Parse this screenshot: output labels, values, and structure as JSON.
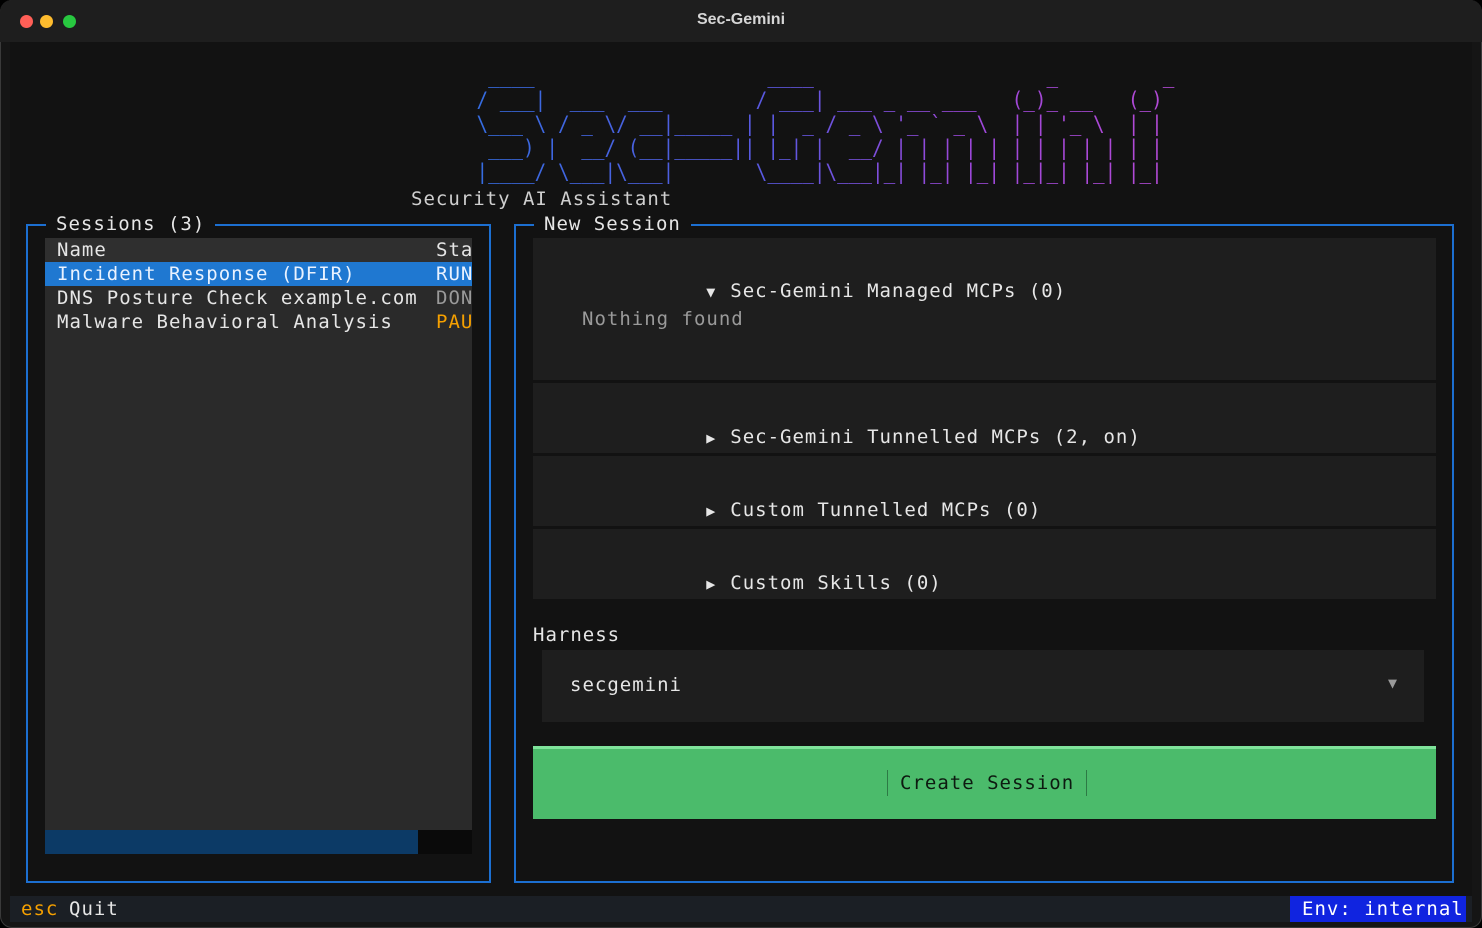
{
  "window": {
    "title": "Sec-Gemini"
  },
  "logo": {
    "ascii": "     ____                    ____                    _         _ \n    / ___|  ___  ___        / ___| ___ _ __ ___   (_)_ __   (_)\n    \\___ \\ / _ \\/ __|_____ | |  _ / _ \\ '_ ` _ \\  | | '_ \\  | |\n     ___) |  __/ (__|_____|| |_| |  __/ | | | | | | | | | | | |\n    |____/ \\___|\\___|       \\____|\\___|_| |_| |_| |_|_| |_| |_|",
    "subtitle": "Security AI Assistant"
  },
  "sessions": {
    "title": "Sessions (3)",
    "columns": [
      "Name",
      "Sta"
    ],
    "rows": [
      {
        "name": "Incident Response (DFIR)",
        "status": "RUN"
      },
      {
        "name": "DNS Posture Check example.com",
        "status": "DON"
      },
      {
        "name": "Malware Behavioral Analysis",
        "status": "PAU"
      }
    ]
  },
  "new_session": {
    "title": "New Session",
    "sections": [
      {
        "arrow": "▼",
        "label": "Sec-Gemini Managed MCPs (0)",
        "body": "Nothing found"
      },
      {
        "arrow": "▶",
        "label": "Sec-Gemini Tunnelled MCPs (2, on)"
      },
      {
        "arrow": "▶",
        "label": "Custom Tunnelled MCPs (0)"
      },
      {
        "arrow": "▶",
        "label": "Custom Skills (0)"
      }
    ],
    "harness": {
      "label": "Harness",
      "value": "secgemini",
      "caret": "▼"
    },
    "create_button": "Create Session"
  },
  "footer": {
    "key": "esc",
    "key_label": "Quit",
    "env": "Env: internal"
  },
  "colors": {
    "accent_border": "#1c6fd1",
    "selection": "#1f78d1",
    "create_button": "#4bbb6b",
    "status_paused": "#f5a000",
    "env_badge": "#1024e0"
  }
}
